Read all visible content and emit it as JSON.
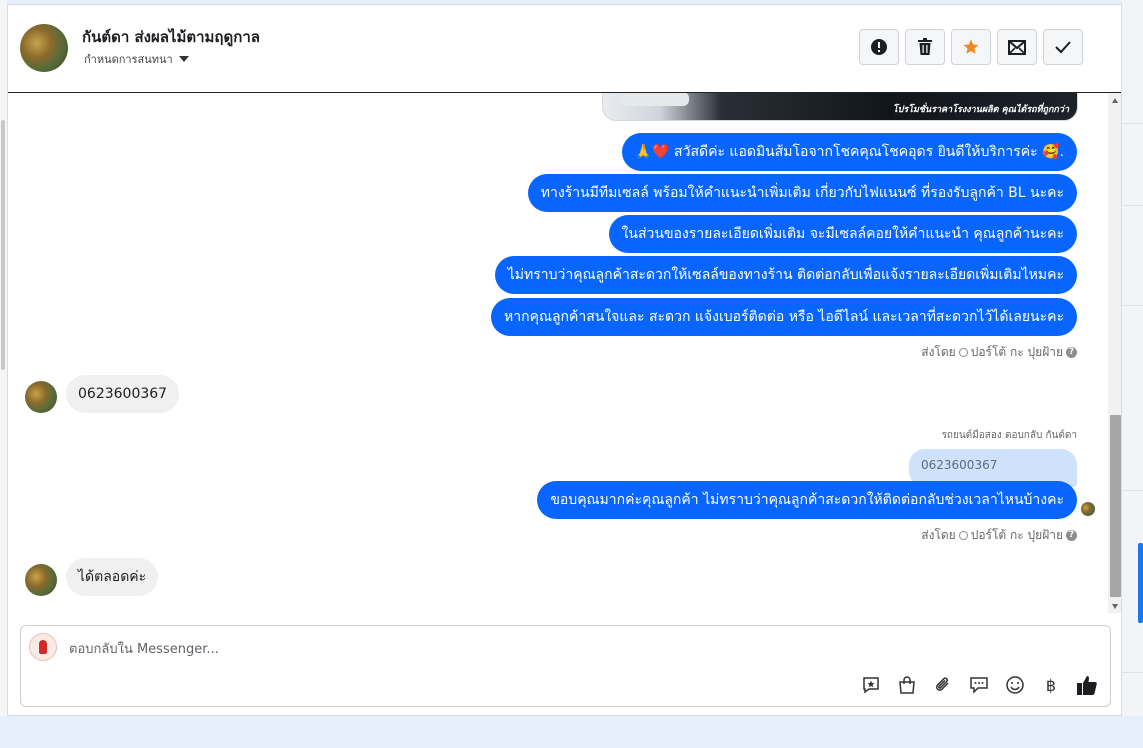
{
  "header": {
    "contact_name": "กันต์ดา ส่งผลไม้ตามฤดูกาล",
    "label_selector": "กำหนดการสนทนา",
    "actions": [
      {
        "name": "report-button",
        "icon": "exclamation-icon"
      },
      {
        "name": "delete-button",
        "icon": "trash-icon"
      },
      {
        "name": "star-button",
        "icon": "star-icon"
      },
      {
        "name": "mark-unread-button",
        "icon": "envelope-x-icon"
      },
      {
        "name": "done-button",
        "icon": "check-icon"
      }
    ]
  },
  "banner": {
    "promo_text": "โปรโมชั่นราคาโรงงานผลิต คุณได้รถที่ถูกกว่า"
  },
  "thread": {
    "outgoing_block_1": [
      "🙏❤️ สวัสดีค่ะ แอดมินส้มโอจากโชคคุณโชคอุดร ยินดีให้บริการค่ะ 🥰.",
      "ทางร้านมีทีมเซลล์ พร้อมให้คำแนะนำเพิ่มเติม เกี่ยวกับไฟแนนซ์ ที่รองรับลูกค้า BL นะคะ",
      "ในส่วนของรายละเอียดเพิ่มเติม จะมีเซลล์คอยให้คำแนะนำ คุณลูกค้านะคะ",
      "ไม่ทราบว่าคุณลูกค้าสะดวกให้เซลล์ของทางร้าน ติดต่อกลับเพื่อแจ้งรายละเอียดเพิ่มเติมไหมคะ",
      "หากคุณลูกค้าสนใจและ สะดวก แจ้งเบอร์ติดต่อ หรือ ไอดีไลน์ และเวลาที่สะดวกไว้ได้เลยนะคะ"
    ],
    "sent_by_1": "ส่งโดย",
    "sender_1": "ปอร์โต้ กะ ปุยฝ้าย",
    "incoming_1": "0623600367",
    "reply_note": "รถยนต์มือสอง ตอบกลับ กันต์ดา",
    "quoted": "0623600367",
    "outgoing_2": "ขอบคุณมากค่ะคุณลูกค้า ไม่ทราบว่าคุณลูกค้าสะดวกให้ติดต่อกลับช่วงเวลาไหนบ้างคะ",
    "sent_by_2": "ส่งโดย",
    "sender_2": "ปอร์โต้ กะ ปุยฝ้าย",
    "incoming_2": "ได้ตลอดค่ะ"
  },
  "composer": {
    "placeholder": "ตอบกลับใน Messenger...",
    "tools": [
      "saved-reply-icon",
      "shopping-bag-icon",
      "paperclip-icon",
      "chat-bubbles-icon",
      "emoji-icon",
      "baht-icon",
      "thumbs-up-icon"
    ]
  },
  "colors": {
    "accent": "#0866ff",
    "incoming_bg": "#f0f0f0",
    "quote_bg": "#cfe2fb",
    "star": "#f08a24"
  }
}
